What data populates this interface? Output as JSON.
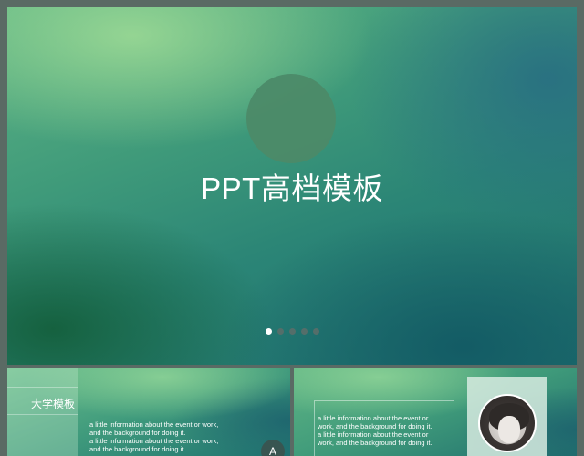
{
  "slide": {
    "title": "PPT高档模板",
    "dots": [
      true,
      false,
      false,
      false,
      false
    ]
  },
  "thumbnails": {
    "left": {
      "panel_title": "大学模板",
      "lines": [
        "a little information about the event or work,",
        "and the background for doing it.",
        "a little information about the event or work,",
        "and the background for doing it."
      ],
      "badge": "A"
    },
    "right": {
      "lines": [
        "a little information about the event or",
        "work, and the background for doing it.",
        "a little information about the event or",
        "work, and the background for doing it."
      ],
      "avatar": "portrait-photo"
    }
  },
  "colors": {
    "frame": "#5a6a64",
    "accent_green": "#5fb585",
    "accent_teal": "#1f6f6e",
    "circle": "#4c8a68"
  }
}
